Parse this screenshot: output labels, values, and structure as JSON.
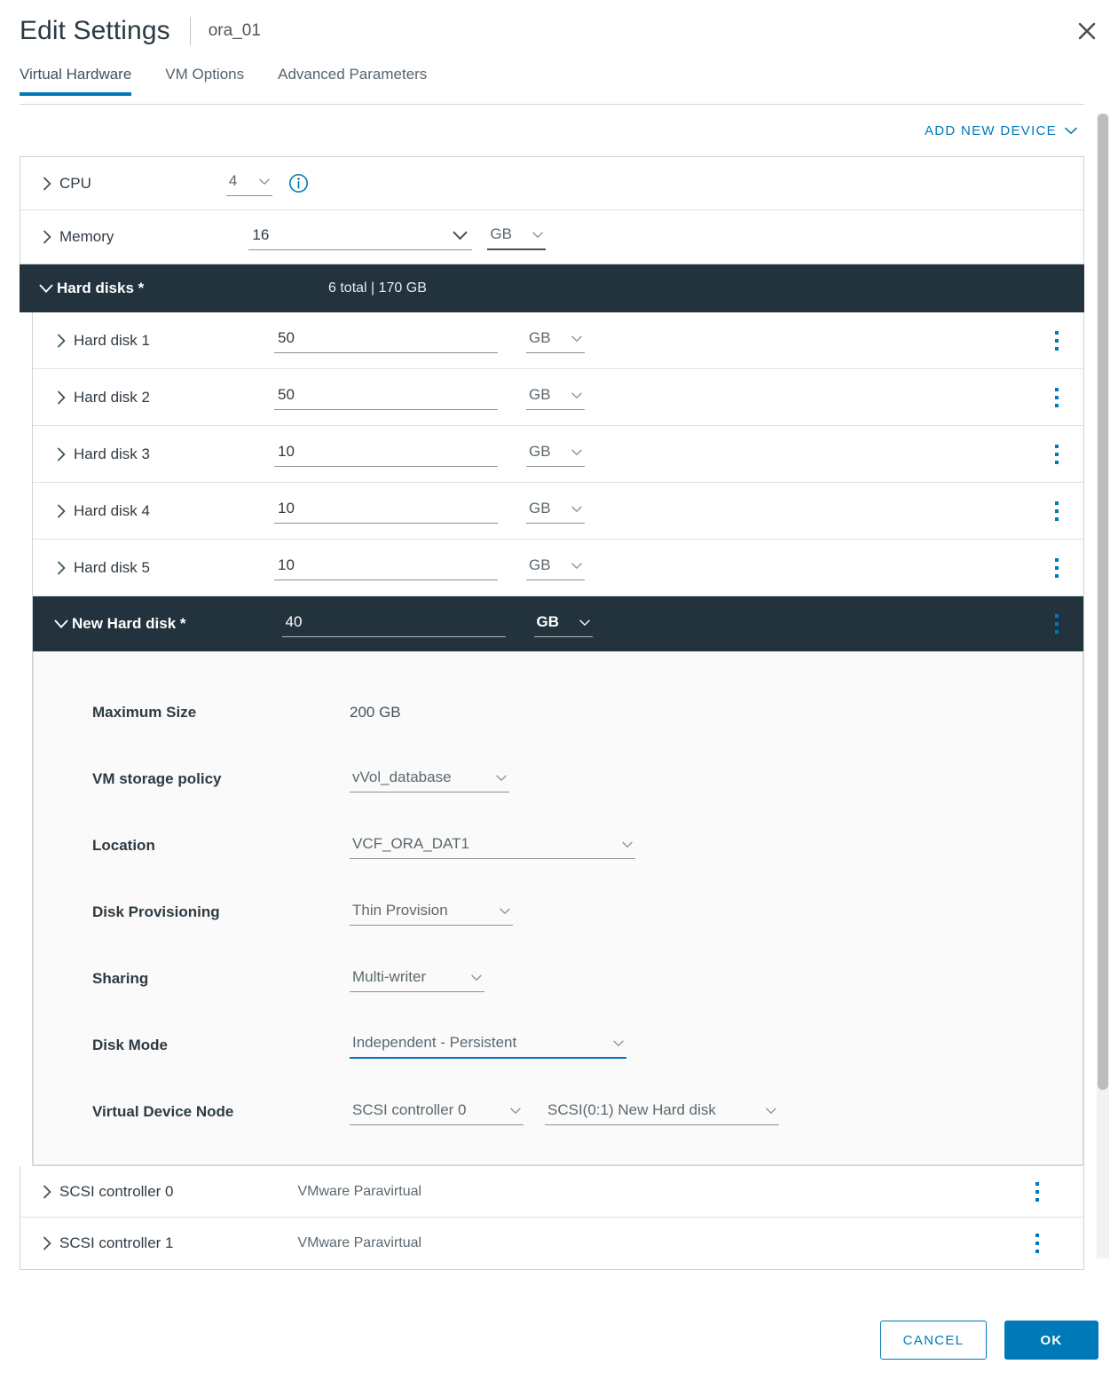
{
  "window": {
    "title": "Edit Settings",
    "subject": "ora_01",
    "close_icon": "close-icon"
  },
  "tabs": [
    {
      "label": "Virtual Hardware",
      "active": true
    },
    {
      "label": "VM Options",
      "active": false
    },
    {
      "label": "Advanced Parameters",
      "active": false
    }
  ],
  "toolbar": {
    "add_new_device_label": "ADD NEW DEVICE",
    "add_new_device_caret": "chevron-down-icon"
  },
  "devices": {
    "cpu": {
      "label": "CPU",
      "value": "4",
      "info_icon": "info-circle-icon"
    },
    "memory": {
      "label": "Memory",
      "value": "16",
      "unit": "GB"
    },
    "hard_disks_section": {
      "label": "Hard disks *",
      "summary": "6 total | 170 GB"
    },
    "hard_disks": [
      {
        "label": "Hard disk 1",
        "size": "50",
        "unit": "GB"
      },
      {
        "label": "Hard disk 2",
        "size": "50",
        "unit": "GB"
      },
      {
        "label": "Hard disk 3",
        "size": "10",
        "unit": "GB"
      },
      {
        "label": "Hard disk 4",
        "size": "10",
        "unit": "GB"
      },
      {
        "label": "Hard disk 5",
        "size": "10",
        "unit": "GB"
      }
    ],
    "new_hard_disk": {
      "label": "New Hard disk *",
      "size": "40",
      "unit": "GB",
      "details": {
        "maximum_size_label": "Maximum Size",
        "maximum_size_value": "200 GB",
        "vm_storage_policy_label": "VM storage policy",
        "vm_storage_policy_value": "vVol_database",
        "location_label": "Location",
        "location_value": "VCF_ORA_DAT1",
        "disk_provisioning_label": "Disk Provisioning",
        "disk_provisioning_value": "Thin Provision",
        "sharing_label": "Sharing",
        "sharing_value": "Multi-writer",
        "disk_mode_label": "Disk Mode",
        "disk_mode_value": "Independent - Persistent",
        "virtual_device_node_label": "Virtual Device Node",
        "virtual_device_node_controller": "SCSI controller 0",
        "virtual_device_node_slot": "SCSI(0:1) New Hard disk"
      }
    },
    "controllers": [
      {
        "label": "SCSI controller 0",
        "value": "VMware Paravirtual"
      },
      {
        "label": "SCSI controller 1",
        "value": "VMware Paravirtual"
      }
    ]
  },
  "footer": {
    "cancel_label": "CANCEL",
    "ok_label": "OK"
  },
  "colors": {
    "accent": "#0079b8",
    "dark_header": "#22333d",
    "text": "#313b44"
  }
}
